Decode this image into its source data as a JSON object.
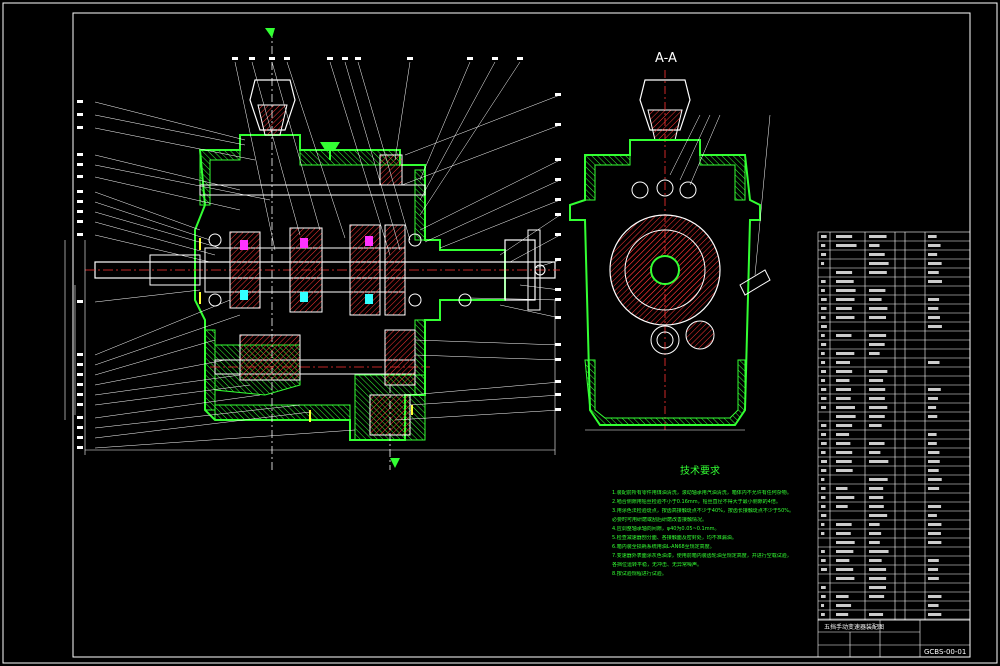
{
  "section_label": "A-A",
  "requirements_title": "技术要求",
  "requirements": [
    "1.装配前所有零件用煤油清洗，滚动轴承用汽油清洗，箱体内不允许有任何杂物。",
    "2.啮合侧隙用铅丝检验不小于0.16mm，铅丝直径不得大于最小侧隙的4倍。",
    "3.用涂色法检验斑点，按齿高接触斑点不少于40%，按齿长接触斑点不少于50%。",
    "   必要时可用研磨或刮后研磨改善接触情况。",
    "4.应调整轴承轴向间隙，φ40为0.05~0.1mm。",
    "5.检查减速器剖分面、各接触面及密封处，均不准漏油。",
    "6.箱内装全损耗系统用油L-AN68至规定高度。",
    "7.变速器外表面涂灰色油漆，使用前箱内装齿轮油至规定高度，并进行空载试验，",
    "   各挡位运转平稳，无冲击、无异常噪声。",
    "8.按试验规程进行试验。"
  ],
  "drawing_number": "GCBS-00-01",
  "title_block_name": "五挡手动变速器装配图",
  "colors": {
    "background": "#000000",
    "outline": "#ffffff",
    "housing": "#33ff33",
    "hatch": "#ff3333",
    "centerline": "#ff3333",
    "magenta": "#ff33ff",
    "cyan": "#33ffff",
    "yellow": "#ffff33"
  }
}
